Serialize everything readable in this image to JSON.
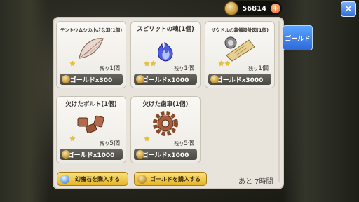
{
  "currency": {
    "amount": "56814",
    "plus_label": "+"
  },
  "close": {
    "label": "✕"
  },
  "tabs": {
    "gold_label": "ゴールド"
  },
  "items": [
    {
      "name": "テントウムシの小さな羽(1個)",
      "stars": "★",
      "stock_prefix": "残り",
      "stock_count": "1個",
      "price": "ゴールドx300"
    },
    {
      "name": "スピリットの魂(1個)",
      "stars": "★★",
      "stock_prefix": "残り",
      "stock_count": "1個",
      "price": "ゴールドx1000"
    },
    {
      "name": "ザクドルの装備設計図(1個)",
      "stars": "★★",
      "stock_prefix": "残り",
      "stock_count": "1個",
      "price": "ゴールドx3000"
    },
    {
      "name": "欠けたボルト(1個)",
      "stars": "★",
      "stock_prefix": "残り",
      "stock_count": "5個",
      "price": "ゴールドx1000"
    },
    {
      "name": "欠けた歯車(1個)",
      "stars": "★",
      "stock_prefix": "残り",
      "stock_count": "5個",
      "price": "ゴールドx1000"
    }
  ],
  "actions": {
    "buy_magic_stone": "幻魔石を購入する",
    "buy_gold": "ゴールドを購入する"
  },
  "timer": "あと 7時間"
}
